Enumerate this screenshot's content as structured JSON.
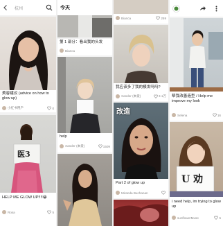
{
  "col1": {
    "search_placeholder": "杭州",
    "cards": [
      {
        "caption": "美容建议 (advice on how to glow up)",
        "author": "小红书用户",
        "likes": "0"
      },
      {
        "caption": "HELP ME GLOW UP!!!!😭",
        "author": "Rosa",
        "likes": "5",
        "sign": "医3"
      }
    ]
  },
  "col2": {
    "header": "今天",
    "cards": [
      {
        "caption": "",
        "author": "",
        "likes": ""
      },
      {
        "caption": "第 1 部分：看出我的头发",
        "author": "Bianca",
        "likes": ""
      },
      {
        "caption": "help",
        "author": "Xander (本爱)",
        "likes": "1509"
      },
      {
        "caption": "",
        "author": "",
        "likes": ""
      }
    ]
  },
  "col3": {
    "cards": [
      {
        "caption": "",
        "author": "Bianca",
        "likes": "259"
      },
      {
        "caption": "我应该多了我的模发吗吗?",
        "author": "Xander (本爱)",
        "likes": "3.1万"
      },
      {
        "caption": "Part 2 of glow up",
        "author": "Miranda Buchanan",
        "likes": ""
      },
      {
        "caption": "",
        "author": "",
        "likes": ""
      }
    ],
    "overlay": "改造"
  },
  "col4": {
    "cards": [
      {
        "caption": "帮我改善造型 / Help me improve my look",
        "author": "Selena",
        "likes": "16"
      },
      {
        "caption": "i need help, im trying to glow up",
        "author": "sunflowerMuse",
        "likes": "5",
        "sign": "U 劝"
      }
    ]
  }
}
